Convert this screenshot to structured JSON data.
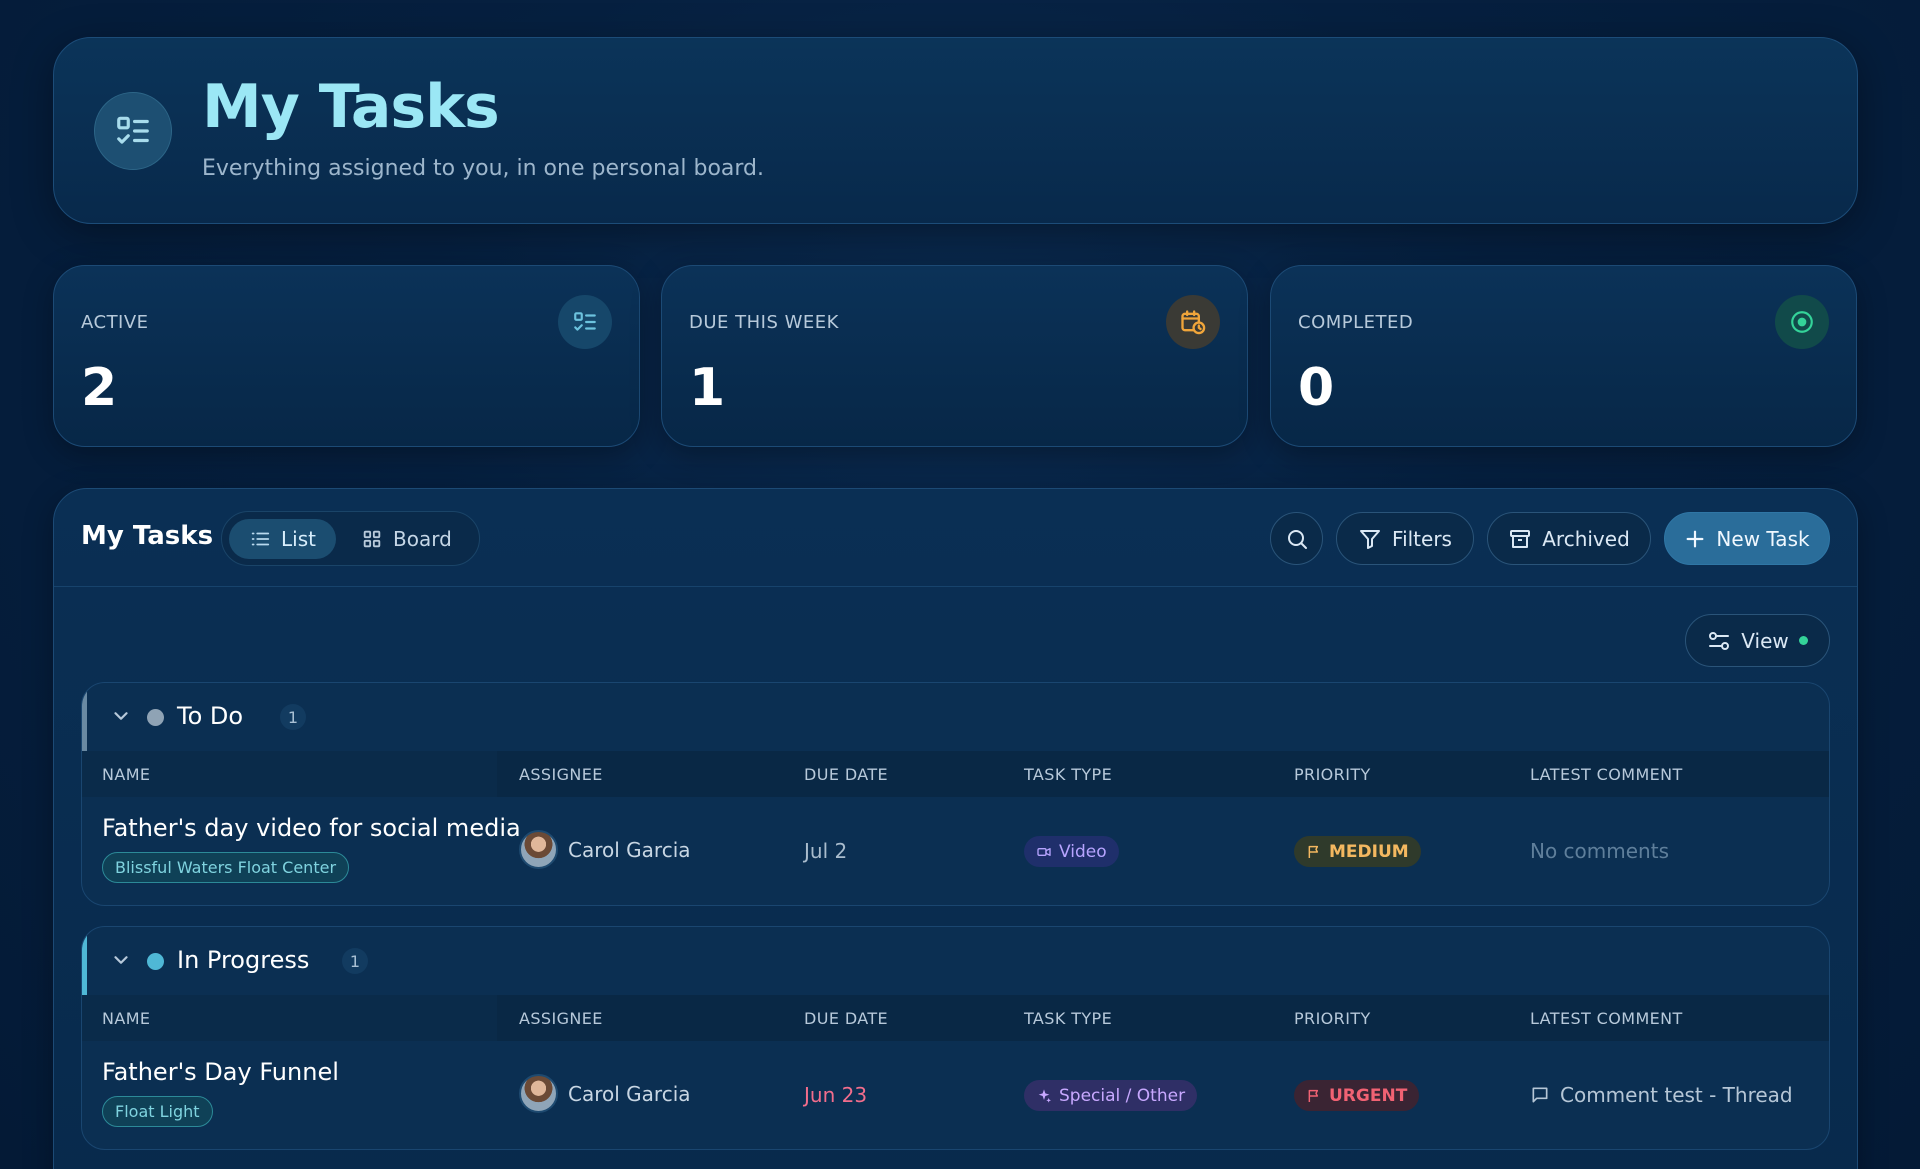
{
  "header": {
    "title": "My Tasks",
    "subtitle": "Everything assigned to you, in one personal board."
  },
  "stats": [
    {
      "label": "ACTIVE",
      "value": "2",
      "icon": "list-check-icon",
      "color": "#4fb8d6"
    },
    {
      "label": "DUE THIS WEEK",
      "value": "1",
      "icon": "calendar-clock-icon",
      "color": "#f0a53a"
    },
    {
      "label": "COMPLETED",
      "value": "0",
      "icon": "circle-check-icon",
      "color": "#34d399"
    }
  ],
  "toolbar": {
    "title": "My Tasks",
    "view_list": "List",
    "view_board": "Board",
    "filters": "Filters",
    "archived": "Archived",
    "new_task": "New Task",
    "view": "View"
  },
  "columns": {
    "name": "NAME",
    "assignee": "ASSIGNEE",
    "due_date": "DUE DATE",
    "task_type": "TASK TYPE",
    "priority": "PRIORITY",
    "latest_comment": "LATEST COMMENT"
  },
  "groups": [
    {
      "name": "To Do",
      "count": "1",
      "dot_color": "#8fa3b5",
      "tasks": [
        {
          "name": "Father's day video for social media",
          "tag": "Blissful Waters Float Center",
          "assignee": "Carol Garcia",
          "due": "Jul 2",
          "type": "Video",
          "priority": "MEDIUM",
          "comment": "No comments"
        }
      ]
    },
    {
      "name": "In Progress",
      "count": "1",
      "dot_color": "#4fb8d6",
      "tasks": [
        {
          "name": "Father's Day Funnel",
          "tag": "Float Light",
          "assignee": "Carol Garcia",
          "due": "Jun 23",
          "type": "Special / Other",
          "priority": "URGENT",
          "comment": "Comment test - Thread"
        }
      ]
    }
  ]
}
